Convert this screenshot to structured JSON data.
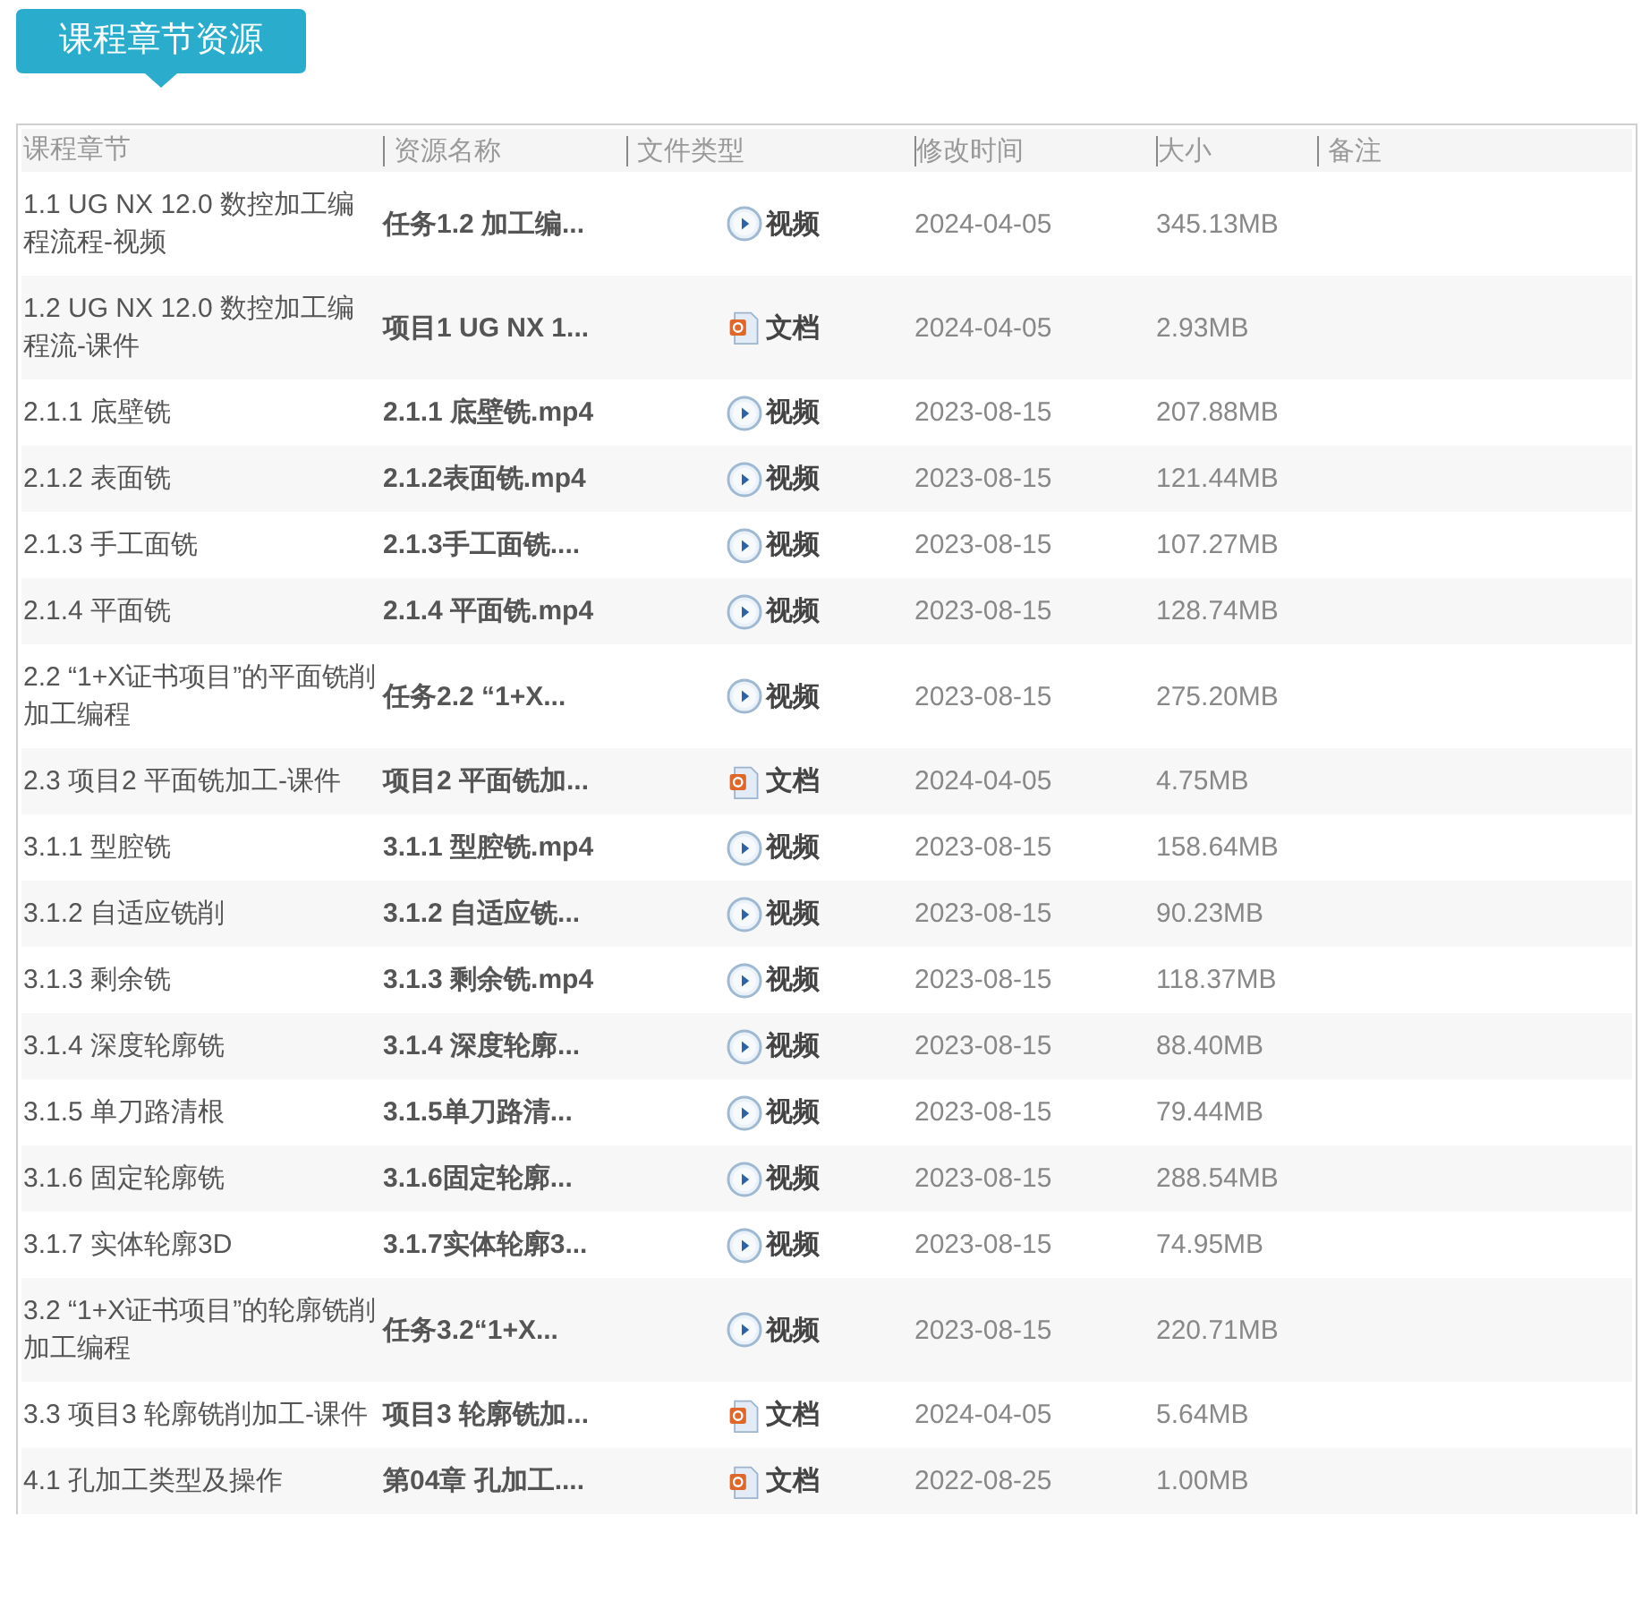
{
  "title": "课程章节资源",
  "columns": [
    "课程章节",
    "资源名称",
    "文件类型",
    "修改时间",
    "大小",
    "备注"
  ],
  "rows": [
    {
      "chapter": "1.1 UG NX 12.0 数控加工编程流程-视频",
      "name": "任务1.2 加工编...",
      "kind": "video",
      "type": "视频",
      "date": "2024-04-05",
      "size": "345.13MB"
    },
    {
      "chapter": "1.2 UG NX 12.0 数控加工编程流-课件",
      "name": "项目1 UG NX 1...",
      "kind": "doc",
      "type": "文档",
      "date": "2024-04-05",
      "size": "2.93MB"
    },
    {
      "chapter": "2.1.1 底壁铣",
      "name": "2.1.1 底壁铣.mp4",
      "kind": "video",
      "type": "视频",
      "date": "2023-08-15",
      "size": "207.88MB"
    },
    {
      "chapter": "2.1.2 表面铣",
      "name": "2.1.2表面铣.mp4",
      "kind": "video",
      "type": "视频",
      "date": "2023-08-15",
      "size": "121.44MB"
    },
    {
      "chapter": "2.1.3 手工面铣",
      "name": "2.1.3手工面铣....",
      "kind": "video",
      "type": "视频",
      "date": "2023-08-15",
      "size": "107.27MB"
    },
    {
      "chapter": "2.1.4 平面铣",
      "name": "2.1.4 平面铣.mp4",
      "kind": "video",
      "type": "视频",
      "date": "2023-08-15",
      "size": "128.74MB"
    },
    {
      "chapter": "2.2 “1+X证书项目”的平面铣削加工编程",
      "name": "任务2.2 “1+X...",
      "kind": "video",
      "type": "视频",
      "date": "2023-08-15",
      "size": "275.20MB"
    },
    {
      "chapter": "2.3 项目2 平面铣加工-课件",
      "name": "项目2 平面铣加...",
      "kind": "doc",
      "type": "文档",
      "date": "2024-04-05",
      "size": "4.75MB"
    },
    {
      "chapter": "3.1.1 型腔铣",
      "name": "3.1.1 型腔铣.mp4",
      "kind": "video",
      "type": "视频",
      "date": "2023-08-15",
      "size": "158.64MB"
    },
    {
      "chapter": "3.1.2 自适应铣削",
      "name": "3.1.2 自适应铣...",
      "kind": "video",
      "type": "视频",
      "date": "2023-08-15",
      "size": "90.23MB"
    },
    {
      "chapter": "3.1.3 剩余铣",
      "name": "3.1.3 剩余铣.mp4",
      "kind": "video",
      "type": "视频",
      "date": "2023-08-15",
      "size": "118.37MB"
    },
    {
      "chapter": "3.1.4 深度轮廓铣",
      "name": "3.1.4 深度轮廓...",
      "kind": "video",
      "type": "视频",
      "date": "2023-08-15",
      "size": "88.40MB"
    },
    {
      "chapter": "3.1.5 单刀路清根",
      "name": "3.1.5单刀路清...",
      "kind": "video",
      "type": "视频",
      "date": "2023-08-15",
      "size": "79.44MB"
    },
    {
      "chapter": "3.1.6 固定轮廓铣",
      "name": "3.1.6固定轮廓...",
      "kind": "video",
      "type": "视频",
      "date": "2023-08-15",
      "size": "288.54MB"
    },
    {
      "chapter": "3.1.7 实体轮廓3D",
      "name": "3.1.7实体轮廓3...",
      "kind": "video",
      "type": "视频",
      "date": "2023-08-15",
      "size": "74.95MB"
    },
    {
      "chapter": "3.2 “1+X证书项目”的轮廓铣削加工编程",
      "name": "任务3.2“1+X...",
      "kind": "video",
      "type": "视频",
      "date": "2023-08-15",
      "size": "220.71MB"
    },
    {
      "chapter": "3.3 项目3 轮廓铣削加工-课件",
      "name": "项目3 轮廓铣加...",
      "kind": "doc",
      "type": "文档",
      "date": "2024-04-05",
      "size": "5.64MB"
    },
    {
      "chapter": "4.1 孔加工类型及操作",
      "name": "第04章 孔加工....",
      "kind": "doc",
      "type": "文档",
      "date": "2022-08-25",
      "size": "1.00MB"
    }
  ]
}
